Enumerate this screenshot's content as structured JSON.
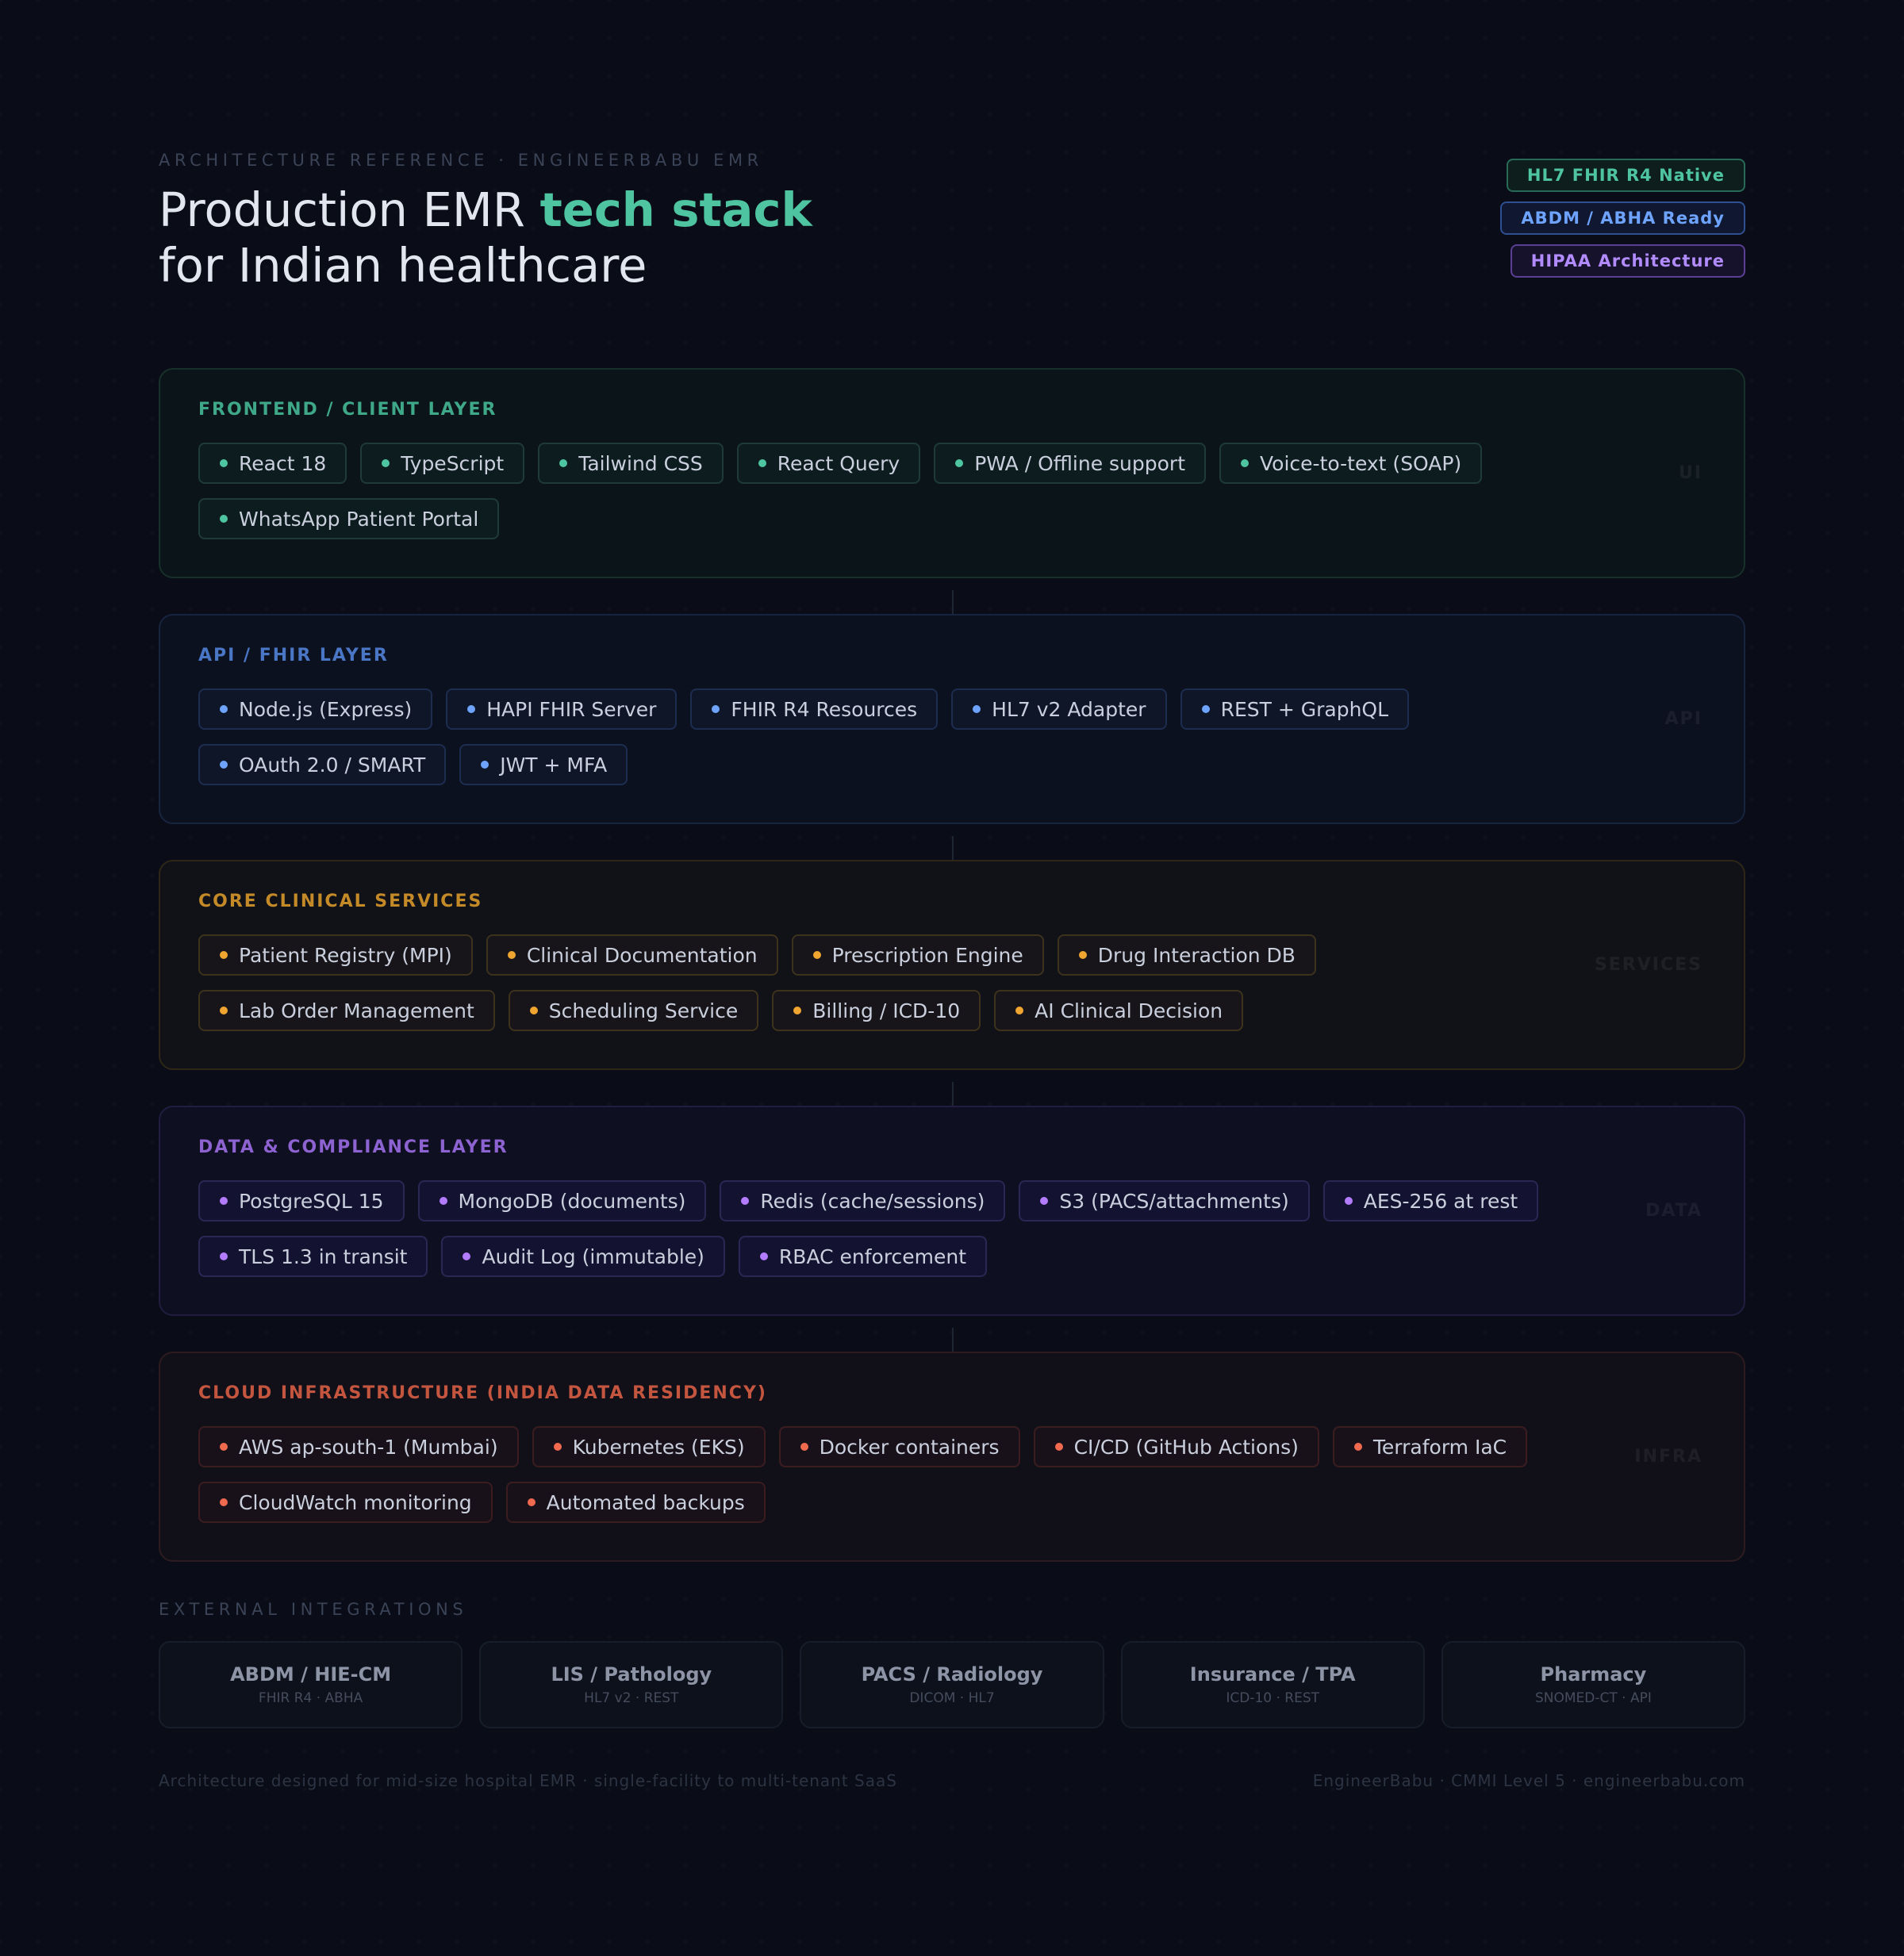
{
  "header": {
    "eyebrow": "ARCHITECTURE REFERENCE · ENGINEERBABU EMR",
    "title_plain": "Production EMR ",
    "title_highlight": "tech stack",
    "title_line2": "for Indian healthcare"
  },
  "badges": [
    "HL7 FHIR R4 Native",
    "ABDM / ABHA Ready",
    "HIPAA Architecture"
  ],
  "layers": [
    {
      "title": "FRONTEND / CLIENT LAYER",
      "ghost": "UI",
      "accent": "#4ec5a0",
      "chips": [
        "React 18",
        "TypeScript",
        "Tailwind CSS",
        "React Query",
        "PWA / Offline support",
        "Voice-to-text (SOAP)",
        "WhatsApp Patient Portal"
      ]
    },
    {
      "title": "API / FHIR LAYER",
      "ghost": "API",
      "accent": "#6ea4ff",
      "chips": [
        "Node.js (Express)",
        "HAPI FHIR Server",
        "FHIR R4 Resources",
        "HL7 v2 Adapter",
        "REST + GraphQL",
        "OAuth 2.0 / SMART",
        "JWT + MFA"
      ]
    },
    {
      "title": "CORE CLINICAL SERVICES",
      "ghost": "SERVICES",
      "accent": "#f0a530",
      "chips": [
        "Patient Registry (MPI)",
        "Clinical Documentation",
        "Prescription Engine",
        "Drug Interaction DB",
        "Lab Order Management",
        "Scheduling Service",
        "Billing / ICD-10",
        "AI Clinical Decision"
      ]
    },
    {
      "title": "DATA & COMPLIANCE LAYER",
      "ghost": "DATA",
      "accent": "#b37cff",
      "chips": [
        "PostgreSQL 15",
        "MongoDB (documents)",
        "Redis (cache/sessions)",
        "S3 (PACS/attachments)",
        "AES-256 at rest",
        "TLS 1.3 in transit",
        "Audit Log (immutable)",
        "RBAC enforcement"
      ]
    },
    {
      "title": "CLOUD INFRASTRUCTURE (INDIA DATA RESIDENCY)",
      "ghost": "INFRA",
      "accent": "#ef6a4e",
      "chips": [
        "AWS ap-south-1 (Mumbai)",
        "Kubernetes (EKS)",
        "Docker containers",
        "CI/CD (GitHub Actions)",
        "Terraform IaC",
        "CloudWatch monitoring",
        "Automated backups"
      ]
    }
  ],
  "external": {
    "label": "EXTERNAL INTEGRATIONS",
    "cards": [
      {
        "name": "ABDM / HIE-CM",
        "sub": "FHIR R4 · ABHA"
      },
      {
        "name": "LIS / Pathology",
        "sub": "HL7 v2 · REST"
      },
      {
        "name": "PACS / Radiology",
        "sub": "DICOM · HL7"
      },
      {
        "name": "Insurance / TPA",
        "sub": "ICD-10 · REST"
      },
      {
        "name": "Pharmacy",
        "sub": "SNOMED-CT · API"
      }
    ]
  },
  "footer": {
    "left": "Architecture designed for mid-size hospital EMR · single-facility to multi-tenant SaaS",
    "right": "EngineerBabu · CMMI Level 5 · engineerbabu.com"
  }
}
